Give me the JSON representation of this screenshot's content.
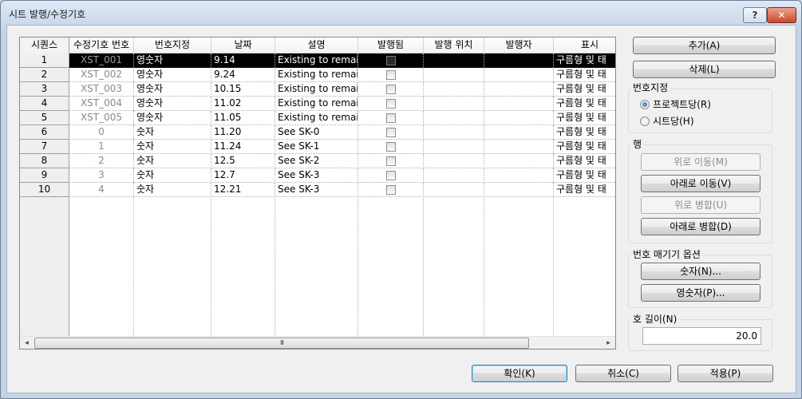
{
  "window": {
    "title": "시트 발행/수정기호",
    "help_label": "?",
    "close_label": "✕"
  },
  "grid": {
    "columns": [
      "시퀀스",
      "수정기호 번호",
      "번호지정",
      "날짜",
      "설명",
      "발행됨",
      "발행 위치",
      "발행자",
      "표시"
    ],
    "rows": [
      {
        "seq": "1",
        "num": "XST_001",
        "numbering": "영숫자",
        "date": "9.14",
        "desc": "Existing to remain",
        "show": "구름형 및 태",
        "selected": true
      },
      {
        "seq": "2",
        "num": "XST_002",
        "numbering": "영숫자",
        "date": "9.24",
        "desc": "Existing to remain",
        "show": "구름형 및 태"
      },
      {
        "seq": "3",
        "num": "XST_003",
        "numbering": "영숫자",
        "date": "10.15",
        "desc": "Existing to remain",
        "show": "구름형 및 태"
      },
      {
        "seq": "4",
        "num": "XST_004",
        "numbering": "영숫자",
        "date": "11.02",
        "desc": "Existing to remain",
        "show": "구름형 및 태"
      },
      {
        "seq": "5",
        "num": "XST_005",
        "numbering": "영숫자",
        "date": "11.05",
        "desc": "Existing to remain",
        "show": "구름형 및 태"
      },
      {
        "seq": "6",
        "num": "0",
        "numbering": "숫자",
        "date": "11.20",
        "desc": "See SK-0",
        "show": "구름형 및 태"
      },
      {
        "seq": "7",
        "num": "1",
        "numbering": "숫자",
        "date": "11.24",
        "desc": "See SK-1",
        "show": "구름형 및 태"
      },
      {
        "seq": "8",
        "num": "2",
        "numbering": "숫자",
        "date": "12.5",
        "desc": "See SK-2",
        "show": "구름형 및 태"
      },
      {
        "seq": "9",
        "num": "3",
        "numbering": "숫자",
        "date": "12.7",
        "desc": "See SK-3",
        "show": "구름형 및 태"
      },
      {
        "seq": "10",
        "num": "4",
        "numbering": "숫자",
        "date": "12.21",
        "desc": "See SK-3",
        "show": "구름형 및 태"
      }
    ],
    "scroll_left": "◂",
    "scroll_right": "▸",
    "scroll_thumb_grip": "III"
  },
  "side": {
    "add_label": "추가(A)",
    "delete_label": "삭제(L)",
    "numbering_group": "번호지정",
    "radio_project": "프로젝트당(R)",
    "radio_sheet": "시트당(H)",
    "row_group": "행",
    "move_up": "위로 이동(M)",
    "move_down": "아래로 이동(V)",
    "merge_up": "위로 병합(U)",
    "merge_down": "아래로 병합(D)",
    "options_group": "번호 매기기 옵션",
    "numeric_btn": "숫자(N)...",
    "alnum_btn": "영숫자(P)...",
    "arc_group": "호 길이(N)",
    "arc_value": "20.0"
  },
  "footer": {
    "ok": "확인(K)",
    "cancel": "취소(C)",
    "apply": "적용(P)"
  }
}
